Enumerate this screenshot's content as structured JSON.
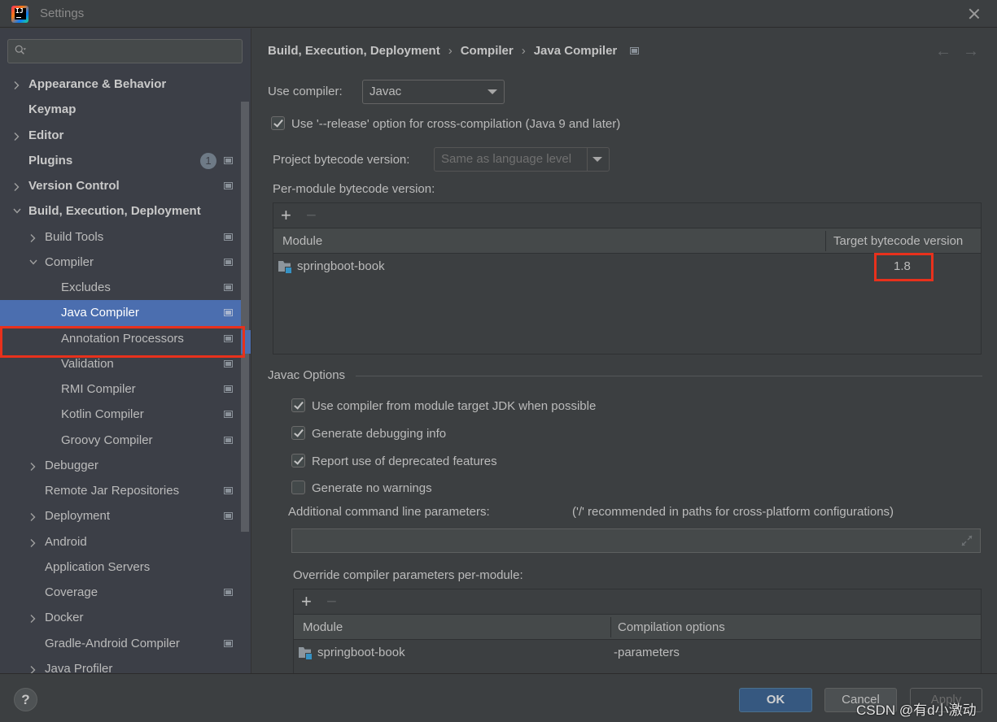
{
  "window": {
    "title": "Settings",
    "close_icon": "close-icon",
    "app_icon": "intellij-idea-logo"
  },
  "sidebar": {
    "search": {
      "placeholder": "",
      "value": "",
      "icon": "search-icon"
    },
    "items": [
      {
        "label": "Appearance & Behavior",
        "level": 0,
        "bold": true,
        "expandable": true,
        "expanded": false,
        "project_icon": false
      },
      {
        "label": "Keymap",
        "level": 0,
        "bold": true,
        "expandable": false,
        "project_icon": false
      },
      {
        "label": "Editor",
        "level": 0,
        "bold": true,
        "expandable": true,
        "expanded": false,
        "project_icon": false
      },
      {
        "label": "Plugins",
        "level": 0,
        "bold": true,
        "expandable": false,
        "badge": "1",
        "project_icon": true
      },
      {
        "label": "Version Control",
        "level": 0,
        "bold": true,
        "expandable": true,
        "expanded": false,
        "project_icon": true
      },
      {
        "label": "Build, Execution, Deployment",
        "level": 0,
        "bold": true,
        "expandable": true,
        "expanded": true,
        "project_icon": false
      },
      {
        "label": "Build Tools",
        "level": 1,
        "expandable": true,
        "expanded": false,
        "project_icon": true
      },
      {
        "label": "Compiler",
        "level": 1,
        "expandable": true,
        "expanded": true,
        "project_icon": true
      },
      {
        "label": "Excludes",
        "level": 2,
        "expandable": false,
        "project_icon": true
      },
      {
        "label": "Java Compiler",
        "level": 2,
        "expandable": false,
        "project_icon": true,
        "selected": true
      },
      {
        "label": "Annotation Processors",
        "level": 2,
        "expandable": false,
        "project_icon": true
      },
      {
        "label": "Validation",
        "level": 2,
        "expandable": false,
        "project_icon": true
      },
      {
        "label": "RMI Compiler",
        "level": 2,
        "expandable": false,
        "project_icon": true
      },
      {
        "label": "Kotlin Compiler",
        "level": 2,
        "expandable": false,
        "project_icon": true
      },
      {
        "label": "Groovy Compiler",
        "level": 2,
        "expandable": false,
        "project_icon": true
      },
      {
        "label": "Debugger",
        "level": 1,
        "expandable": true,
        "expanded": false,
        "project_icon": false
      },
      {
        "label": "Remote Jar Repositories",
        "level": 1,
        "expandable": false,
        "project_icon": true
      },
      {
        "label": "Deployment",
        "level": 1,
        "expandable": true,
        "expanded": false,
        "project_icon": true
      },
      {
        "label": "Android",
        "level": 1,
        "expandable": true,
        "expanded": false,
        "project_icon": false
      },
      {
        "label": "Application Servers",
        "level": 1,
        "expandable": false,
        "project_icon": false
      },
      {
        "label": "Coverage",
        "level": 1,
        "expandable": false,
        "project_icon": true
      },
      {
        "label": "Docker",
        "level": 1,
        "expandable": true,
        "expanded": false,
        "project_icon": false
      },
      {
        "label": "Gradle-Android Compiler",
        "level": 1,
        "expandable": false,
        "project_icon": true
      },
      {
        "label": "Java Profiler",
        "level": 1,
        "expandable": true,
        "expanded": false,
        "project_icon": false
      }
    ]
  },
  "breadcrumb": {
    "items": [
      "Build, Execution, Deployment",
      "Compiler",
      "Java Compiler"
    ],
    "separator": "›",
    "back_icon": "←",
    "forward_icon": "→"
  },
  "compiler": {
    "use_compiler_label": "Use compiler:",
    "use_compiler_value": "Javac",
    "release_option_label": "Use '--release' option for cross-compilation (Java 9 and later)",
    "release_option_checked": true,
    "project_bytecode_label": "Project bytecode version:",
    "project_bytecode_value": "Same as language level",
    "per_module_label": "Per-module bytecode version:"
  },
  "bytecode_table": {
    "add_label": "+",
    "remove_label": "−",
    "columns": [
      "Module",
      "Target bytecode version"
    ],
    "rows": [
      {
        "module": "springboot-book",
        "target": "1.8"
      }
    ]
  },
  "javac_options": {
    "title": "Javac Options",
    "checkboxes": [
      {
        "label": "Use compiler from module target JDK when possible",
        "checked": true
      },
      {
        "label": "Generate debugging info",
        "checked": true
      },
      {
        "label": "Report use of deprecated features",
        "checked": true
      },
      {
        "label": "Generate no warnings",
        "checked": false
      }
    ],
    "additional_params_label": "Additional command line parameters:",
    "additional_params_hint": "('/' recommended in paths for cross-platform configurations)",
    "additional_params_value": "",
    "override_label": "Override compiler parameters per-module:"
  },
  "override_table": {
    "add_label": "+",
    "remove_label": "−",
    "columns": [
      "Module",
      "Compilation options"
    ],
    "rows": [
      {
        "module": "springboot-book",
        "options": "-parameters"
      }
    ]
  },
  "footer": {
    "help_label": "?",
    "ok_label": "OK",
    "cancel_label": "Cancel",
    "apply_label": "Apply",
    "watermark": "CSDN @有d小激动"
  },
  "colors": {
    "selection": "#4b6eaf",
    "highlight_outline": "#e8311c",
    "ok_button": "#365880",
    "background": "#3c3f41"
  }
}
